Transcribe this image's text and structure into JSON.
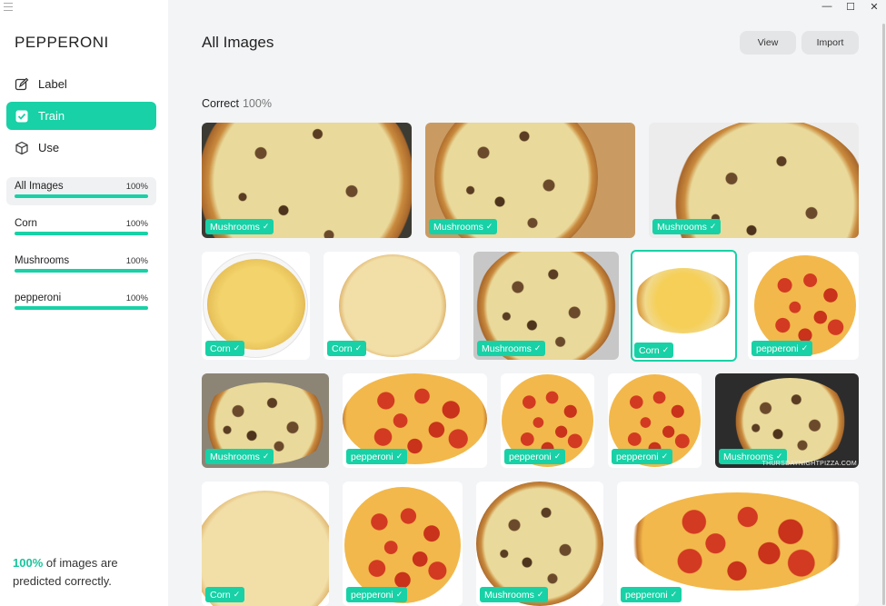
{
  "app": {
    "title": "PEPPERONI"
  },
  "window_controls": {
    "minimize": "—",
    "maximize": "☐",
    "close": "✕"
  },
  "nav": [
    {
      "label": "Label",
      "icon": "edit-icon",
      "active": false
    },
    {
      "label": "Train",
      "icon": "checkbox-icon",
      "active": true
    },
    {
      "label": "Use",
      "icon": "cube-icon",
      "active": false
    }
  ],
  "categories": [
    {
      "name": "All Images",
      "pct": "100%",
      "progress": 1.0
    },
    {
      "name": "Corn",
      "pct": "100%",
      "progress": 1.0
    },
    {
      "name": "Mushrooms",
      "pct": "100%",
      "progress": 1.0
    },
    {
      "name": "pepperoni",
      "pct": "100%",
      "progress": 1.0
    }
  ],
  "summary": {
    "highlight": "100%",
    "text": " of images are predicted correctly."
  },
  "header": {
    "title": "All Images",
    "view_label": "View",
    "import_label": "Import"
  },
  "section": {
    "label": "Correct",
    "pct": "100%"
  },
  "check_glyph": "✓",
  "images": [
    {
      "label": "Mushrooms"
    },
    {
      "label": "Mushrooms"
    },
    {
      "label": "Mushrooms"
    },
    {
      "label": "Corn"
    },
    {
      "label": "Corn"
    },
    {
      "label": "Mushrooms"
    },
    {
      "label": "Corn",
      "selected": true
    },
    {
      "label": "pepperoni"
    },
    {
      "label": "Mushrooms"
    },
    {
      "label": "pepperoni"
    },
    {
      "label": "pepperoni"
    },
    {
      "label": "pepperoni"
    },
    {
      "label": "Mushrooms",
      "watermark": "THURSDAYNIGHTPIZZA.COM"
    },
    {
      "label": "Corn"
    },
    {
      "label": "pepperoni"
    },
    {
      "label": "Mushrooms"
    },
    {
      "label": "pepperoni"
    }
  ],
  "colors": {
    "accent": "#18d1a6",
    "background": "#f3f4f6"
  }
}
